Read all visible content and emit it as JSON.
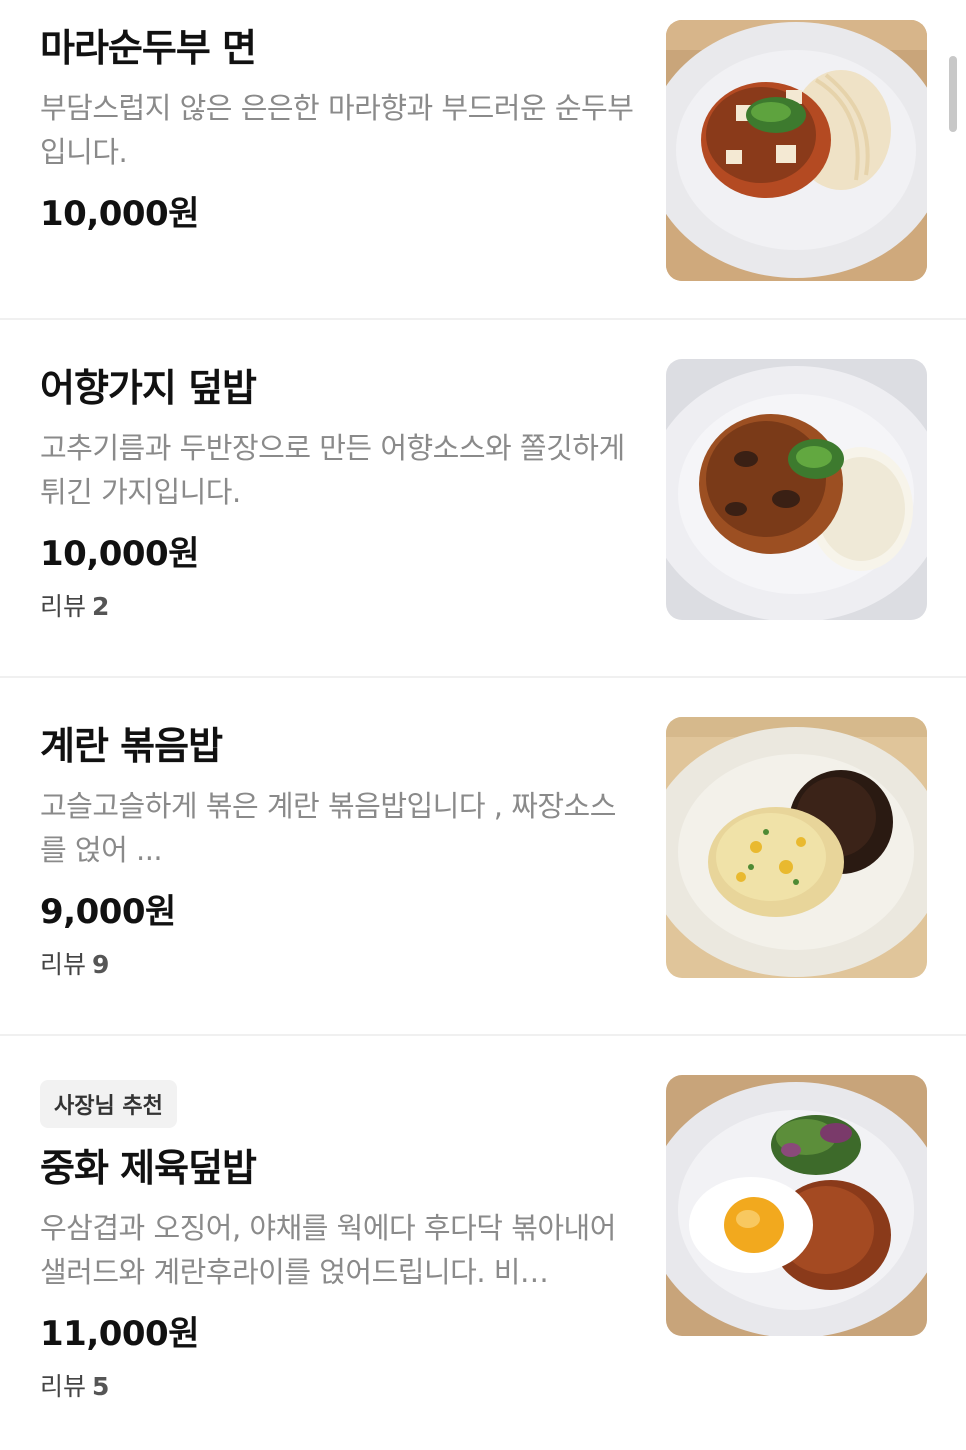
{
  "menu": {
    "items": [
      {
        "name": "마라순두부 면",
        "description": "부담스럽지 않은 은은한 마라향과 부드러운 순두부 입니다.",
        "price": "10,000원",
        "badge": "",
        "review_label": "",
        "review_count": "",
        "image_icon": "mapo-tofu-noodle-photo"
      },
      {
        "name": "어향가지 덮밥",
        "description": "고추기름과 두반장으로 만든 어향소스와 쫄깃하게 튀긴 가지입니다.",
        "price": "10,000원",
        "badge": "",
        "review_label": "리뷰",
        "review_count": "2",
        "image_icon": "eggplant-rice-photo"
      },
      {
        "name": "계란 볶음밥",
        "description": "고슬고슬하게 볶은 계란 볶음밥입니다 , 짜장소스를 얹어 ...",
        "price": "9,000원",
        "badge": "",
        "review_label": "리뷰",
        "review_count": "9",
        "image_icon": "egg-fried-rice-photo"
      },
      {
        "name": "중화 제육덮밥",
        "description": "우삼겹과 오징어, 야채를 웍에다 후다닥 볶아내어 샐러드와 계란후라이를  얹어드립니다. 비…",
        "price": "11,000원",
        "badge": "사장님 추천",
        "review_label": "리뷰",
        "review_count": "5",
        "image_icon": "spicy-pork-rice-photo"
      }
    ]
  },
  "colors": {
    "text_primary": "#111111",
    "text_secondary": "#8a8a8a",
    "divider": "#f0f0f0",
    "badge_bg": "#f2f2f2"
  }
}
